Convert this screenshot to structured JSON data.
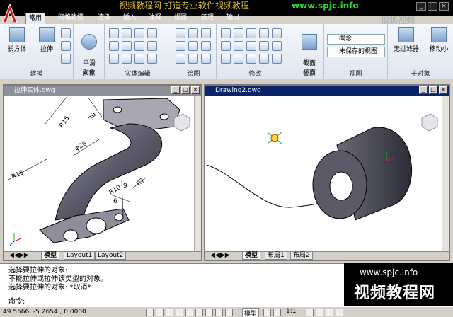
{
  "title_bar": {
    "text": "视频教程网 打造专业软件视频教程",
    "url": "www.spjc.info"
  },
  "ribbon_tabs": [
    "常用",
    "网格建模",
    "渲染",
    "插入",
    "注释",
    "视图",
    "管理",
    "输出"
  ],
  "panels": {
    "modeling": {
      "title": "建模",
      "box_label": "长方体",
      "extrude_label": "拉伸"
    },
    "mesh": {
      "title": "网格",
      "smooth_label": "平滑\n对象"
    },
    "solid_edit": {
      "title": "实体编辑"
    },
    "draw": {
      "title": "绘图"
    },
    "modify": {
      "title": "修改"
    },
    "section": {
      "title": "截...",
      "section_plane_label": "截面\n平面"
    },
    "view": {
      "title": "视图",
      "visual_style": "概念",
      "saved_view": "未保存的视图"
    },
    "subobject": {
      "title": "子对象",
      "no_filter_label": "无过滤器",
      "move_label": "移动小"
    }
  },
  "left_window": {
    "title": "拉伸实体.dwg",
    "layout_tabs": [
      "模型",
      "Layout1",
      "Layout2"
    ],
    "dimensions": [
      "R15",
      "30",
      "R15",
      "φ26",
      "R10",
      "9",
      "R7",
      "6"
    ]
  },
  "right_window": {
    "title": "Drawing2.dwg",
    "layout_tabs": [
      "模型",
      "布局1",
      "布局2"
    ]
  },
  "command_history": [
    "选择要拉伸的对象:",
    "不能拉伸或拉伸该类型的对象。",
    "选择要拉伸的对象: *取消*"
  ],
  "command_prompt": "命令:",
  "watermark": {
    "url": "www.spjc.info",
    "brand": "视频教程网"
  },
  "status": {
    "coords": "49.5566, -5.2654 , 0.0000",
    "model_label": "模型",
    "scale": "1:1"
  },
  "ribbon_watermark": "搜狐视频"
}
